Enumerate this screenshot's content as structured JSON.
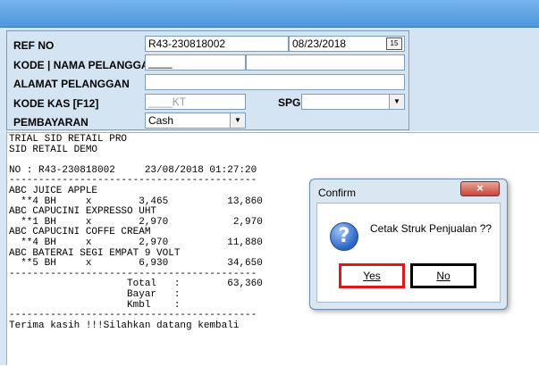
{
  "form": {
    "ref_no_label": "REF NO",
    "ref_no_value": "R43-230818002",
    "date_value": "08/23/2018",
    "calendar_icon_text": "15",
    "kode_nama_label": "KODE | NAMA PELANGGAN",
    "kode_value": "____",
    "nama_value": "",
    "alamat_label": "ALAMAT PELANGGAN",
    "alamat_value": "",
    "kode_kas_label": "KODE KAS [F12]",
    "kode_kas_value": "____KT",
    "spg_label": "SPG",
    "spg_value": "",
    "pembayaran_label": "PEMBAYARAN",
    "pembayaran_value": "Cash"
  },
  "receipt": {
    "text": "TRIAL SID RETAIL PRO\nSID RETAIL DEMO\n\nNO : R43-230818002     23/08/2018 01:27:20\n------------------------------------------\nABC JUICE APPLE\n  **4 BH     x        3,465          13,860\nABC CAPUCINI EXPRESSO UHT\n  **1 BH     x        2,970           2,970\nABC CAPUCINI COFFE CREAM\n  **4 BH     x        2,970          11,880\nABC BATERAI SEGI EMPAT 9 VOLT\n  **5 BH     x        6,930          34,650\n------------------------------------------\n                    Total   :        63,360\n                    Bayar   :\n                    Kmbl    :\n------------------------------------------\nTerima kasih !!!Silahkan datang kembali"
  },
  "dialog": {
    "title": "Confirm",
    "close_icon": "×",
    "question_icon": "?",
    "message": "Cetak Struk Penjualan ??",
    "yes_label": "Yes",
    "no_label": "No"
  },
  "icons": {
    "calendar": "calendar-icon",
    "dropdown": "chevron-down-icon",
    "question": "question-icon",
    "close": "close-icon"
  },
  "colors": {
    "form_background": "#d4e4f3",
    "title_bar": "#5ea3e6",
    "yes_highlight": "#e01818",
    "no_highlight": "#000000"
  }
}
